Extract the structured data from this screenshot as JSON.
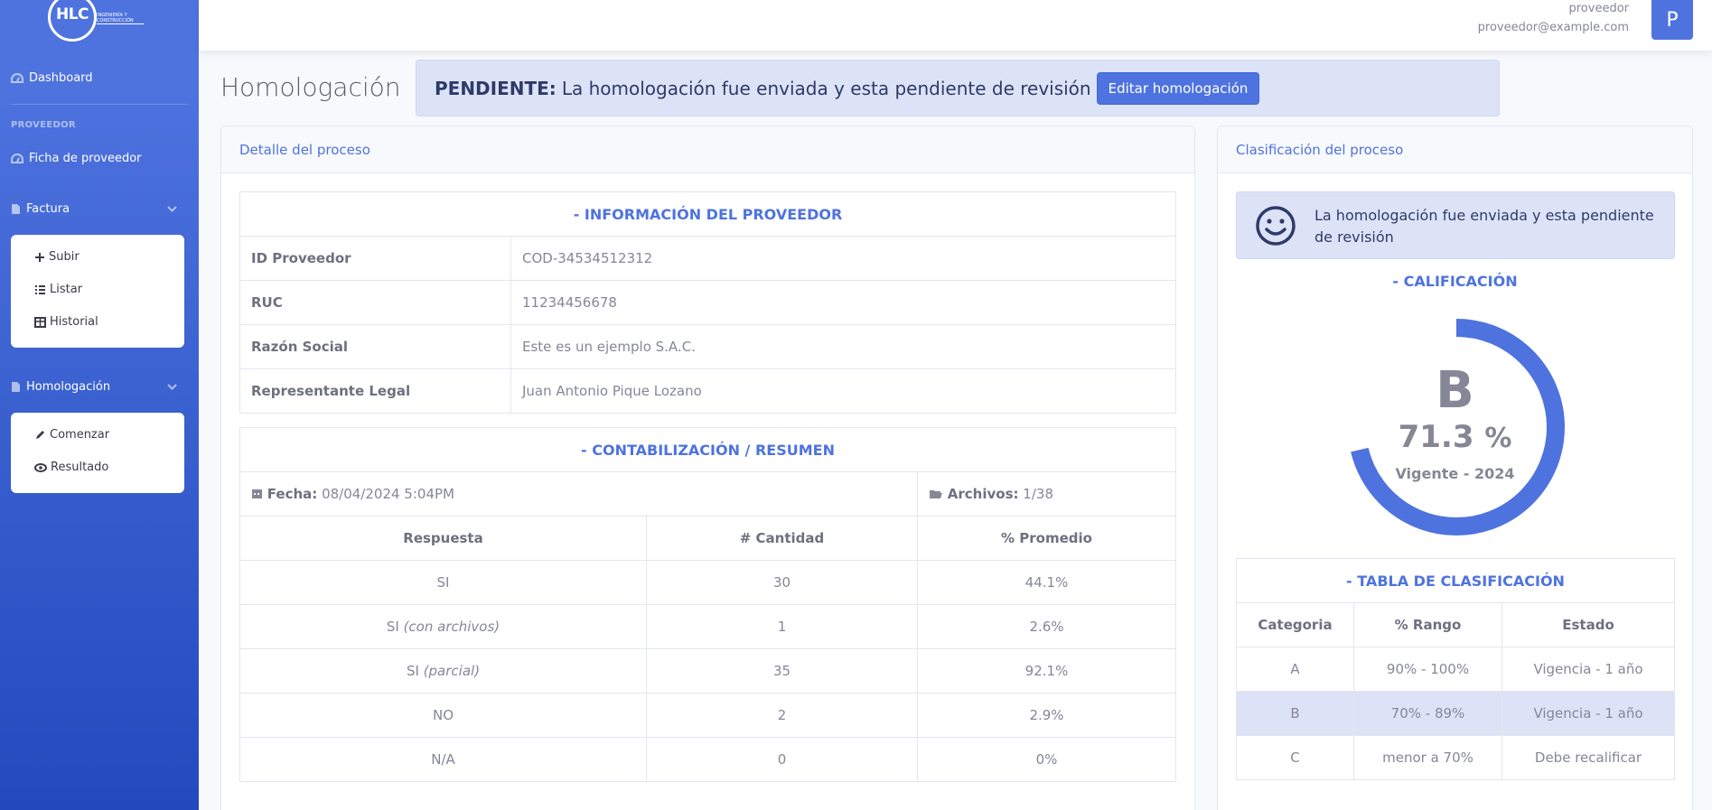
{
  "sidebar": {
    "brand_text": "HLC",
    "brand_sub": "Ingeniería y Construcción",
    "dashboard": "Dashboard",
    "heading": "PROVEEDOR",
    "ficha": "Ficha de proveedor",
    "factura": {
      "label": "Factura",
      "items": [
        "Subir",
        "Listar",
        "Historial"
      ]
    },
    "homologacion": {
      "label": "Homologación",
      "items": [
        "Comenzar",
        "Resultado"
      ]
    }
  },
  "topbar": {
    "user_name": "proveedor",
    "user_email": "proveedor@example.com",
    "avatar_letter": "P"
  },
  "page": {
    "title": "Homologación",
    "alert_bold": "PENDIENTE:",
    "alert_text": "La homologación fue enviada y esta pendiente de revisión",
    "edit_button": "Editar homologación"
  },
  "detalle": {
    "header": "Detalle del proceso",
    "info_title": "- INFORMACIÓN DEL PROVEEDOR",
    "rows": [
      {
        "label": "ID Proveedor",
        "value": "COD-34534512312"
      },
      {
        "label": "RUC",
        "value": "11234456678"
      },
      {
        "label": "Razón Social",
        "value": "Este es un ejemplo S.A.C."
      },
      {
        "label": "Representante Legal",
        "value": "Juan Antonio Pique Lozano"
      }
    ],
    "resumen_title": "- CONTABILIZACIÓN / RESUMEN",
    "fecha_label": "Fecha:",
    "fecha_value": "08/04/2024 5:04PM",
    "archivos_label": "Archivos:",
    "archivos_value": "1/38",
    "columns": [
      "Respuesta",
      "# Cantidad",
      "% Promedio"
    ],
    "resumen_rows": [
      {
        "respuesta": "SI",
        "note": "",
        "cantidad": "30",
        "promedio": "44.1%"
      },
      {
        "respuesta": "SI",
        "note": "(con archivos)",
        "cantidad": "1",
        "promedio": "2.6%"
      },
      {
        "respuesta": "SI",
        "note": "(parcial)",
        "cantidad": "35",
        "promedio": "92.1%"
      },
      {
        "respuesta": "NO",
        "note": "",
        "cantidad": "2",
        "promedio": "2.9%"
      },
      {
        "respuesta": "N/A",
        "note": "",
        "cantidad": "0",
        "promedio": "0%"
      }
    ]
  },
  "clasificacion": {
    "header": "Clasificación del proceso",
    "info_text": "La homologación fue enviada y esta pendiente de revisión",
    "cal_title": "- CALIFICACIÓN",
    "grade": "B",
    "percent": "71.3",
    "percent_sign": "%",
    "score_fraction": 0.713,
    "vigente": "Vigente - 2024",
    "tabla_title": "- TABLA DE CLASIFICACIÓN",
    "columns": [
      "Categoria",
      "% Rango",
      "Estado"
    ],
    "rows": [
      {
        "cat": "A",
        "rango": "90% - 100%",
        "estado": "Vigencia - 1 año",
        "active": false
      },
      {
        "cat": "B",
        "rango": "70% - 89%",
        "estado": "Vigencia - 1 año",
        "active": true
      },
      {
        "cat": "C",
        "rango": "menor a 70%",
        "estado": "Debe recalificar",
        "active": false
      }
    ]
  },
  "colors": {
    "primary": "#4e73df",
    "alert_bg": "#dde3f7"
  }
}
